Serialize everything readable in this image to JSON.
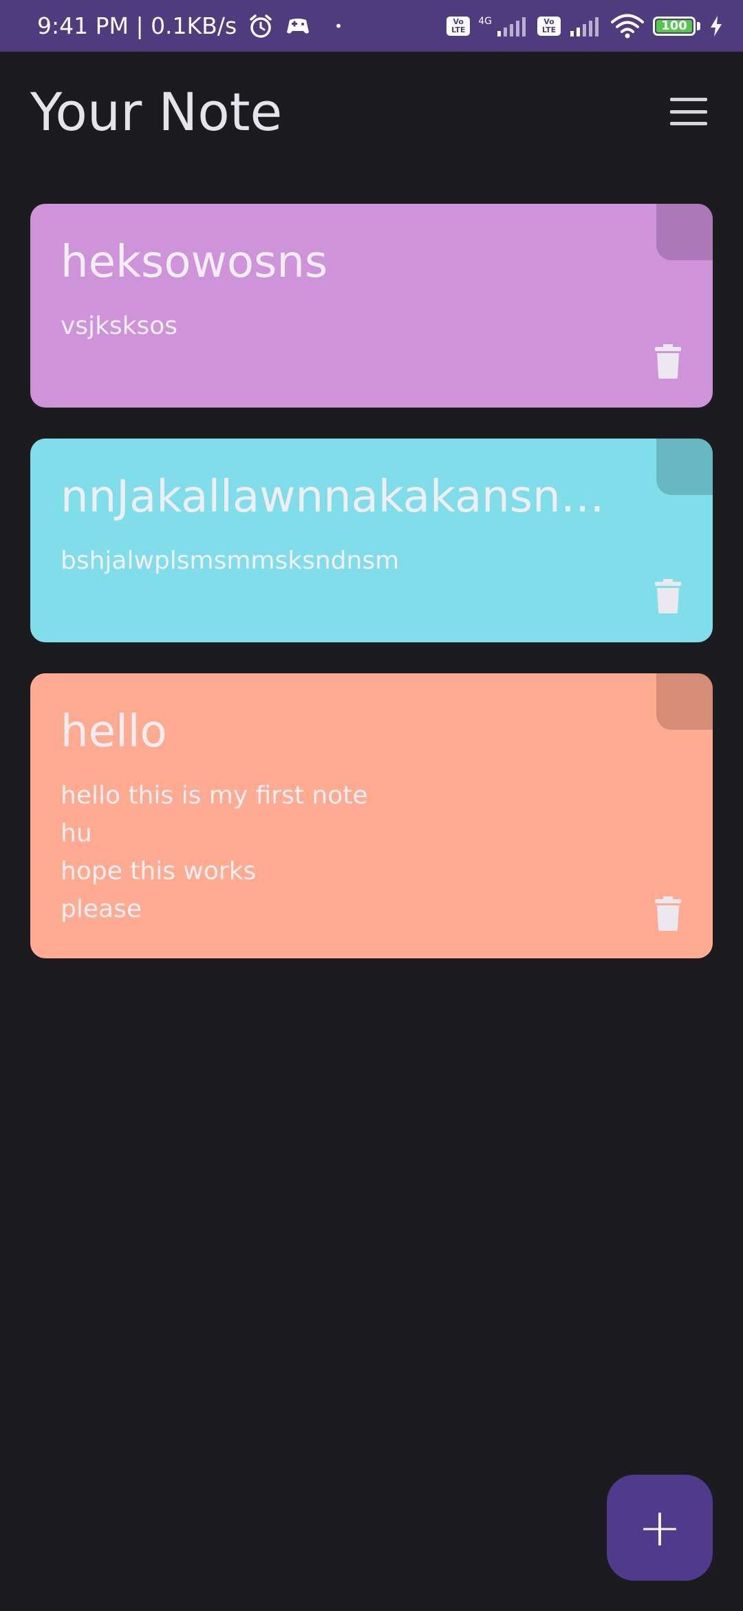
{
  "status_bar": {
    "time_speed": "9:41 PM | 0.1KB/s",
    "dot": "•",
    "network_type": "4G",
    "volte_label_top": "Vo",
    "volte_label_bottom": "LTE",
    "battery_level": "100"
  },
  "header": {
    "title": "Your Note"
  },
  "notes": [
    {
      "title": "heksowosns",
      "body": "vsjksksos",
      "color": "#ce93d8",
      "fold_color": "#ad78b8"
    },
    {
      "title": "nnJakallawnnakakansnnsnsnsmjs",
      "body": "bshjalwplsmsmmsksndnsm",
      "color": "#80deea",
      "fold_color": "#68b8c3"
    },
    {
      "title": "hello",
      "body": "hello this is my first note\nhu\nhope this works\nplease",
      "color": "#ffab91",
      "fold_color": "#d58d78"
    }
  ],
  "fab": {
    "label": "+"
  },
  "colors": {
    "background": "#1c1b20",
    "status_bar": "#4f3c7e",
    "fab": "#4f3a8c"
  }
}
